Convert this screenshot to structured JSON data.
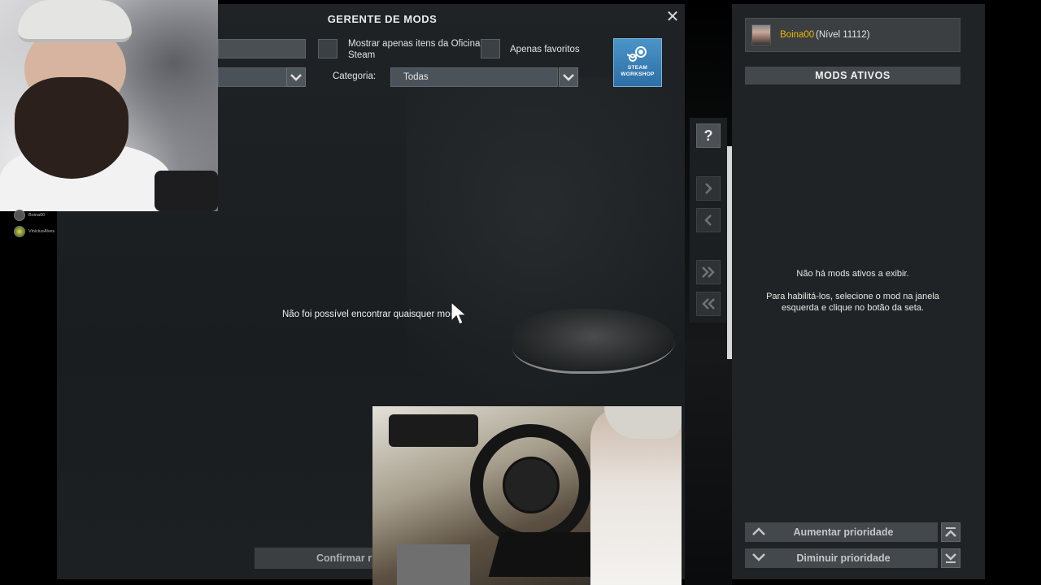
{
  "mod_manager": {
    "title": "GERENTE DE MODS",
    "close_symbol": "✕",
    "search": {
      "value": ""
    },
    "sort_select": {
      "value": ""
    },
    "checkbox_steam_only": {
      "label_line1": "Mostrar apenas itens da Oficina",
      "label_line2": "Steam",
      "checked": false
    },
    "checkbox_favorites": {
      "label": "Apenas favoritos",
      "checked": false
    },
    "category": {
      "label": "Categoria:",
      "value": "Todas"
    },
    "workshop_button": {
      "line1": "STEAM",
      "line2": "WORKSHOP"
    },
    "empty_message": "Não foi possível encontrar quaisquer mods",
    "confirm_button": "Confirmar r"
  },
  "middle_controls": {
    "help": "?"
  },
  "active_panel": {
    "user_name": "Boina00",
    "user_level": "(Nível 11112)",
    "header": "MODS ATIVOS",
    "empty_line1": "Não há mods ativos a exibir.",
    "empty_line2": "Para habilitá-los, selecione o mod na janela",
    "empty_line3": "esquerda e clique no botão da seta.",
    "increase_priority": "Aumentar prioridade",
    "decrease_priority": "Diminuir prioridade"
  },
  "stream_overlay": {
    "viewers": [
      "Boina00",
      "ViniciusAlves"
    ]
  },
  "colors": {
    "username": "#f0b800",
    "workshop_blue": "#3a82b8",
    "panel_bg": "#1f2325"
  }
}
